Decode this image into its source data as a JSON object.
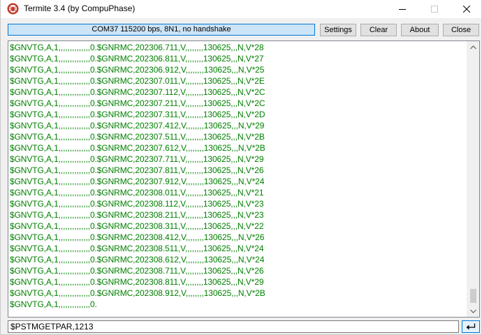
{
  "window": {
    "title": "Termite 3.4 (by CompuPhase)",
    "colors": {
      "accent": "#0078d7",
      "status_bg": "#cce4f7",
      "text_green": "#008000"
    }
  },
  "icons": {
    "app": "termite-app-icon",
    "minimize": "minimize-icon",
    "maximize": "maximize-icon",
    "close": "close-icon",
    "scroll_up": "chevron-up-icon",
    "scroll_down": "chevron-down-icon",
    "enter": "enter-return-icon"
  },
  "toolbar": {
    "status": "COM37 115200 bps, 8N1, no handshake",
    "settings_label": "Settings",
    "clear_label": "Clear",
    "about_label": "About",
    "close_label": "Close"
  },
  "terminal": {
    "lines": [
      "$GNVTG,A,1,,,,,,,,,,,,,,0.$GNRMC,202306.711,V,,,,,,,,130625,,,N,V*28",
      "$GNVTG,A,1,,,,,,,,,,,,,,0.$GNRMC,202306.811,V,,,,,,,,130625,,,N,V*27",
      "$GNVTG,A,1,,,,,,,,,,,,,,0.$GNRMC,202306.912,V,,,,,,,,130625,,,N,V*25",
      "$GNVTG,A,1,,,,,,,,,,,,,,0.$GNRMC,202307.011,V,,,,,,,,130625,,,N,V*2E",
      "$GNVTG,A,1,,,,,,,,,,,,,,0.$GNRMC,202307.112,V,,,,,,,,130625,,,N,V*2C",
      "$GNVTG,A,1,,,,,,,,,,,,,,0.$GNRMC,202307.211,V,,,,,,,,130625,,,N,V*2C",
      "$GNVTG,A,1,,,,,,,,,,,,,,0.$GNRMC,202307.311,V,,,,,,,,130625,,,N,V*2D",
      "$GNVTG,A,1,,,,,,,,,,,,,,0.$GNRMC,202307.412,V,,,,,,,,130625,,,N,V*29",
      "$GNVTG,A,1,,,,,,,,,,,,,,0.$GNRMC,202307.511,V,,,,,,,,130625,,,N,V*2B",
      "$GNVTG,A,1,,,,,,,,,,,,,,0.$GNRMC,202307.612,V,,,,,,,,130625,,,N,V*2B",
      "$GNVTG,A,1,,,,,,,,,,,,,,0.$GNRMC,202307.711,V,,,,,,,,130625,,,N,V*29",
      "$GNVTG,A,1,,,,,,,,,,,,,,0.$GNRMC,202307.811,V,,,,,,,,130625,,,N,V*26",
      "$GNVTG,A,1,,,,,,,,,,,,,,0.$GNRMC,202307.912,V,,,,,,,,130625,,,N,V*24",
      "$GNVTG,A,1,,,,,,,,,,,,,,0.$GNRMC,202308.011,V,,,,,,,,130625,,,N,V*21",
      "$GNVTG,A,1,,,,,,,,,,,,,,0.$GNRMC,202308.112,V,,,,,,,,130625,,,N,V*23",
      "$GNVTG,A,1,,,,,,,,,,,,,,0.$GNRMC,202308.211,V,,,,,,,,130625,,,N,V*23",
      "$GNVTG,A,1,,,,,,,,,,,,,,0.$GNRMC,202308.311,V,,,,,,,,130625,,,N,V*22",
      "$GNVTG,A,1,,,,,,,,,,,,,,0.$GNRMC,202308.412,V,,,,,,,,130625,,,N,V*26",
      "$GNVTG,A,1,,,,,,,,,,,,,,0.$GNRMC,202308.511,V,,,,,,,,130625,,,N,V*24",
      "$GNVTG,A,1,,,,,,,,,,,,,,0.$GNRMC,202308.612,V,,,,,,,,130625,,,N,V*24",
      "$GNVTG,A,1,,,,,,,,,,,,,,0.$GNRMC,202308.711,V,,,,,,,,130625,,,N,V*26",
      "$GNVTG,A,1,,,,,,,,,,,,,,0.$GNRMC,202308.811,V,,,,,,,,130625,,,N,V*29",
      "$GNVTG,A,1,,,,,,,,,,,,,,0.$GNRMC,202308.912,V,,,,,,,,130625,,,N,V*2B",
      "$GNVTG,A,1,,,,,,,,,,,,,,0."
    ]
  },
  "input": {
    "value": "$PSTMGETPAR,1213"
  }
}
